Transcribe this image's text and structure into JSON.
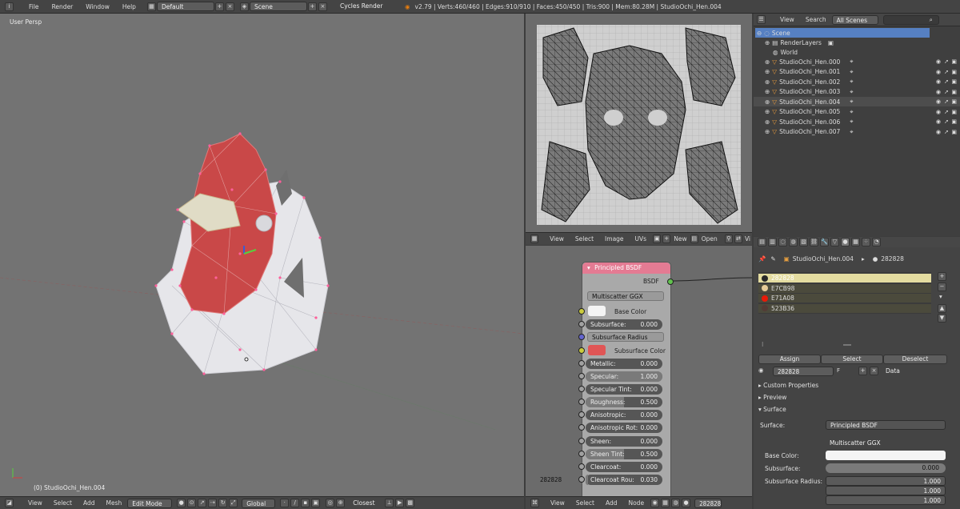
{
  "topbar": {
    "menus": [
      "File",
      "Render",
      "Window",
      "Help"
    ],
    "screen_layout": "Default",
    "scene": "Scene",
    "render_engine": "Cycles Render",
    "stats": "v2.79 | Verts:460/460 | Edges:910/910 | Faces:450/450 | Tris:900 | Mem:80.28M | StudioOchi_Hen.004"
  },
  "viewport": {
    "view_label": "User Persp",
    "object_label": "(0) StudioOchi_Hen.004",
    "header": {
      "menus": [
        "View",
        "Select",
        "Add",
        "Mesh"
      ],
      "mode": "Edit Mode",
      "orientation": "Global",
      "snap": "Closest"
    }
  },
  "uv_editor": {
    "header": {
      "menus": [
        "View",
        "Select",
        "Image",
        "UVs"
      ],
      "new_label": "New",
      "open_label": "Open",
      "view_label": "Vi"
    }
  },
  "outliner": {
    "header": {
      "view": "View",
      "search": "Search",
      "filter": "All Scenes"
    },
    "scene": "Scene",
    "render_layers": "RenderLayers",
    "world": "World",
    "objects": [
      "StudioOchi_Hen.000",
      "StudioOchi_Hen.001",
      "StudioOchi_Hen.002",
      "StudioOchi_Hen.003",
      "StudioOchi_Hen.004",
      "StudioOchi_Hen.005",
      "StudioOchi_Hen.006",
      "StudioOchi_Hen.007"
    ],
    "active_index": 4
  },
  "node_editor": {
    "node_title": "Principled BSDF",
    "output_label": "BSDF",
    "distribution": "Multiscatter GGX",
    "base_color_label": "Base Color",
    "subsurface_radius_label": "Subsurface Radius",
    "subsurface_color_label": "Subsurface Color",
    "fields": [
      {
        "label": "Subsurface:",
        "value": "0.000",
        "fill": 0.0
      },
      {
        "label": "Metallic:",
        "value": "0.000",
        "fill": 0.0
      },
      {
        "label": "Specular:",
        "value": "1.000",
        "fill": 1.0
      },
      {
        "label": "Specular Tint:",
        "value": "0.000",
        "fill": 0.0
      },
      {
        "label": "Roughness:",
        "value": "0.500",
        "fill": 0.5
      },
      {
        "label": "Anisotropic:",
        "value": "0.000",
        "fill": 0.0
      },
      {
        "label": "Anisotropic Rot:",
        "value": "0.000",
        "fill": 0.0
      },
      {
        "label": "Sheen:",
        "value": "0.000",
        "fill": 0.0
      },
      {
        "label": "Sheen Tint:",
        "value": "0.500",
        "fill": 0.5
      },
      {
        "label": "Clearcoat:",
        "value": "0.000",
        "fill": 0.0
      },
      {
        "label": "Clearcoat Rou:",
        "value": "0.030",
        "fill": 0.03
      }
    ],
    "material_label": "282828",
    "header": {
      "menus": [
        "View",
        "Select",
        "Add",
        "Node"
      ],
      "material": "282828"
    }
  },
  "properties": {
    "breadcrumb_object": "StudioOchi_Hen.004",
    "breadcrumb_material": "282828",
    "materials": [
      {
        "name": "282828",
        "color": "#282828"
      },
      {
        "name": "E7CB98",
        "color": "#E7CB98"
      },
      {
        "name": "E71A08",
        "color": "#E71A08"
      },
      {
        "name": "523B36",
        "color": "#523B36"
      }
    ],
    "assign": "Assign",
    "select": "Select",
    "deselect": "Deselect",
    "material_field": "282828",
    "data_dropdown": "Data",
    "panels": [
      "Custom Properties",
      "Preview",
      "Surface"
    ],
    "surface_label": "Surface:",
    "surface_value": "Principled BSDF",
    "distribution": "Multiscatter GGX",
    "base_color_label": "Base Color:",
    "subsurface_label": "Subsurface:",
    "subsurface_value": "0.000",
    "subsurface_radius_label": "Subsurface Radius:",
    "radius_values": [
      "1.000",
      "1.000",
      "1.000"
    ]
  }
}
